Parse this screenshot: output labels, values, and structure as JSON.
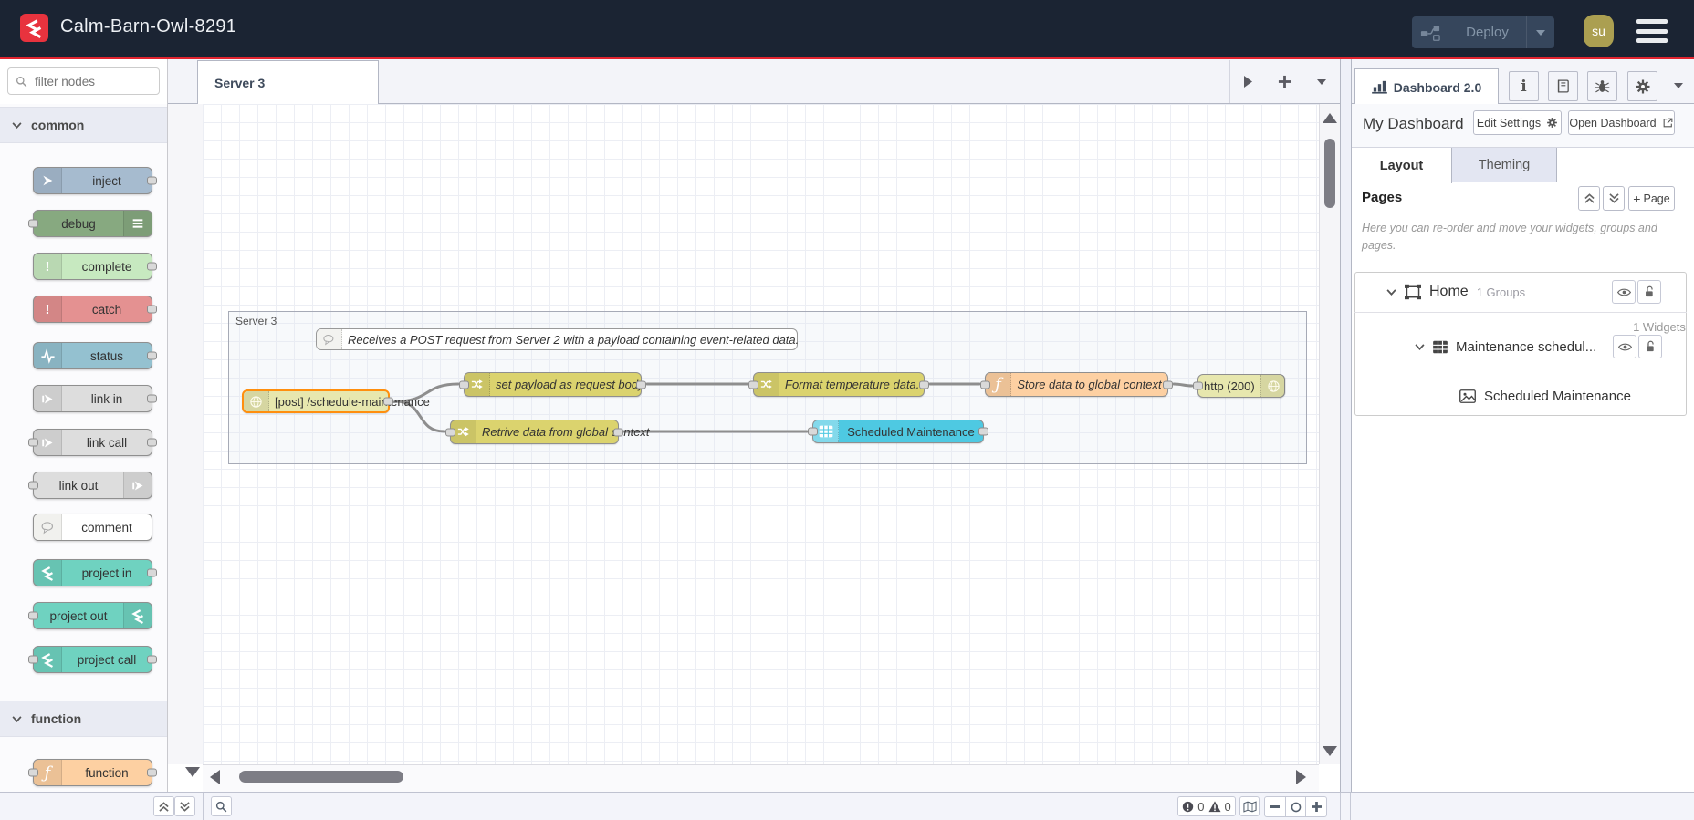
{
  "header": {
    "title": "Calm-Barn-Owl-8291",
    "deploy_label": "Deploy",
    "avatar": "su"
  },
  "palette": {
    "filter_placeholder": "filter nodes",
    "categories": [
      {
        "label": "common",
        "items": [
          {
            "label": "inject",
            "color": "#a6bbcf",
            "icon": "inject-arrow-icon",
            "ports": "out"
          },
          {
            "label": "debug",
            "color": "#87a980",
            "icon": "debug-lines-icon",
            "ports": "in"
          },
          {
            "label": "complete",
            "color": "#c7e9c0",
            "icon": "exclamation-icon",
            "ports": "out"
          },
          {
            "label": "catch",
            "color": "#e49191",
            "icon": "exclamation-icon",
            "ports": "out"
          },
          {
            "label": "status",
            "color": "#94c1d0",
            "icon": "pulse-icon",
            "ports": "out"
          },
          {
            "label": "link in",
            "color": "#dddddd",
            "icon": "link-icon",
            "ports": "out"
          },
          {
            "label": "link call",
            "color": "#dddddd",
            "icon": "link-icon",
            "ports": "both"
          },
          {
            "label": "link out",
            "color": "#dddddd",
            "icon": "link-icon",
            "ports": "in"
          },
          {
            "label": "comment",
            "color": "#ffffff",
            "icon": "comment-bubble-icon",
            "ports": "none"
          },
          {
            "label": "project in",
            "color": "#6fd2c0",
            "icon": "flowfuse-icon",
            "ports": "out"
          },
          {
            "label": "project out",
            "color": "#6fd2c0",
            "icon": "flowfuse-icon",
            "ports": "in"
          },
          {
            "label": "project call",
            "color": "#6fd2c0",
            "icon": "flowfuse-icon",
            "ports": "both"
          }
        ]
      },
      {
        "label": "function",
        "items": [
          {
            "label": "function",
            "color": "#fdd0a2",
            "icon": "function-f-icon",
            "ports": "both"
          }
        ]
      }
    ]
  },
  "workspace": {
    "tab": "Server 3",
    "group_label": "Server 3",
    "comment_text": "Receives a POST request from Server 2 with a payload containing event-related data.",
    "nodes": [
      {
        "label": "[post] /schedule-maintenance",
        "type": "http in",
        "color": "#e7e7ae",
        "selected": true
      },
      {
        "label": "set payload as request body",
        "type": "change",
        "color": "#dbd36e"
      },
      {
        "label": "Retrive data from global context",
        "type": "change",
        "color": "#dbd36e"
      },
      {
        "label": "Format temperature data.",
        "type": "change",
        "color": "#dbd36e"
      },
      {
        "label": "Store data to global context",
        "type": "function",
        "color": "#fdd0a2"
      },
      {
        "label": "http (200)",
        "type": "http response",
        "color": "#e7e7ae"
      },
      {
        "label": "Scheduled Maintenance",
        "type": "ui-table",
        "color": "#4ec9e2"
      }
    ]
  },
  "sidebar": {
    "tab_label": "Dashboard 2.0",
    "board_title": "My Dashboard",
    "edit_settings_label": "Edit Settings",
    "open_dashboard_label": "Open Dashboard",
    "tabs": [
      "Layout",
      "Theming"
    ],
    "pages_title": "Pages",
    "add_page_label": "Page",
    "help_text": "Here you can re-order and move your widgets, groups and pages.",
    "tree": {
      "page": "Home",
      "page_meta": "1 Groups",
      "group": "Maintenance schedul...",
      "group_meta": "1 Widgets",
      "widget": "Scheduled Maintenance"
    }
  },
  "footer": {
    "error_count": "0",
    "warning_count": "0"
  },
  "colors": {
    "header_bg": "#1b2433",
    "accent_red": "#e2242f",
    "selection_orange": "#ff8f0e",
    "avatar_bg": "#ab9f51",
    "sidebar_tab_idle": "#e3e6f2"
  }
}
